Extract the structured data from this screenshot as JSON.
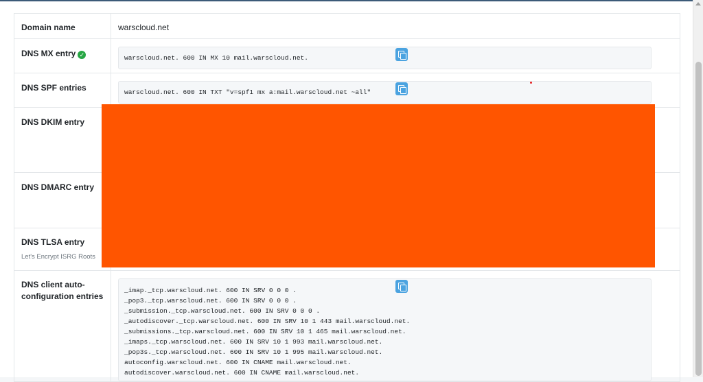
{
  "colors": {
    "accent": "#4ba3e0",
    "redaction": "#ff5500",
    "success": "#28a745"
  },
  "rows": {
    "domain": {
      "label": "Domain name",
      "value": "warscloud.net"
    },
    "mx": {
      "label": "DNS MX entry",
      "value": "warscloud.net. 600 IN MX 10 mail.warscloud.net.",
      "status_icon": "check-circle-icon"
    },
    "spf": {
      "label": "DNS SPF entries",
      "value": "warscloud.net. 600 IN TXT \"v=spf1 mx a:mail.warscloud.net ~all\""
    },
    "dkim": {
      "label": "DNS DKIM entry"
    },
    "dmarc": {
      "label": "DNS DMARC entry"
    },
    "tlsa": {
      "label": "DNS TLSA entry",
      "sublabel": "Let's Encrypt ISRG Roots"
    },
    "autoconf": {
      "label": "DNS client auto-configuration entries",
      "value": "_imap._tcp.warscloud.net. 600 IN SRV 0 0 0 .\n_pop3._tcp.warscloud.net. 600 IN SRV 0 0 0 .\n_submission._tcp.warscloud.net. 600 IN SRV 0 0 0 .\n_autodiscover._tcp.warscloud.net. 600 IN SRV 10 1 443 mail.warscloud.net.\n_submissions._tcp.warscloud.net. 600 IN SRV 10 1 465 mail.warscloud.net.\n_imaps._tcp.warscloud.net. 600 IN SRV 10 1 993 mail.warscloud.net.\n_pop3s._tcp.warscloud.net. 600 IN SRV 10 1 995 mail.warscloud.net.\nautoconfig.warscloud.net. 600 IN CNAME mail.warscloud.net.\nautodiscover.warscloud.net. 600 IN CNAME mail.warscloud.net."
    }
  },
  "copy_icon": "copy-icon"
}
